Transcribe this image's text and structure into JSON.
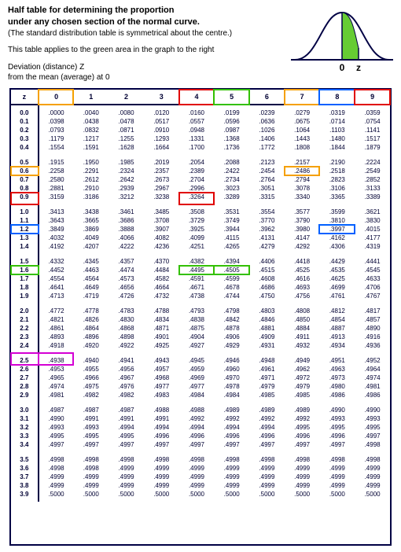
{
  "header": {
    "title": "Half table for determining the proportion",
    "title2": "under any chosen section of the normal curve.",
    "note": "(The standard distribution table is symmetrical about the centre.)",
    "applies": "This table applies to the green area in the graph to the right",
    "dev1": "Deviation (distance) Z",
    "dev2": "from the mean (average) at 0"
  },
  "curve": {
    "zero": "0",
    "z": "z"
  },
  "columns": [
    "z",
    "0",
    "1",
    "2",
    "3",
    "4",
    "5",
    "6",
    "7",
    "8",
    "9"
  ],
  "z_labels": [
    "0.0",
    "0.1",
    "0.2",
    "0.3",
    "0.4",
    "0.5",
    "0.6",
    "0.7",
    "0.8",
    "0.9",
    "1.0",
    "1.1",
    "1.2",
    "1.3",
    "1.4",
    "1.5",
    "1.6",
    "1.7",
    "1.8",
    "1.9",
    "2.0",
    "2.1",
    "2.2",
    "2.3",
    "2.4",
    "2.5",
    "2.6",
    "2.7",
    "2.8",
    "2.9",
    "3.0",
    "3.1",
    "3.2",
    "3.3",
    "3.4",
    "3.5",
    "3.6",
    "3.7",
    "3.8",
    "3.9"
  ],
  "rows": [
    [
      ".0000",
      ".0040",
      ".0080",
      ".0120",
      ".0160",
      ".0199",
      ".0239",
      ".0279",
      ".0319",
      ".0359"
    ],
    [
      ".0398",
      ".0438",
      ".0478",
      ".0517",
      ".0557",
      ".0596",
      ".0636",
      ".0675",
      ".0714",
      ".0754"
    ],
    [
      ".0793",
      ".0832",
      ".0871",
      ".0910",
      ".0948",
      ".0987",
      ".1026",
      ".1064",
      ".1103",
      ".1141"
    ],
    [
      ".1179",
      ".1217",
      ".1255",
      ".1293",
      ".1331",
      ".1368",
      ".1406",
      ".1443",
      ".1480",
      ".1517"
    ],
    [
      ".1554",
      ".1591",
      ".1628",
      ".1664",
      ".1700",
      ".1736",
      ".1772",
      ".1808",
      ".1844",
      ".1879"
    ],
    [
      ".1915",
      ".1950",
      ".1985",
      ".2019",
      ".2054",
      ".2088",
      ".2123",
      ".2157",
      ".2190",
      ".2224"
    ],
    [
      ".2258",
      ".2291",
      ".2324",
      ".2357",
      ".2389",
      ".2422",
      ".2454",
      ".2486",
      ".2518",
      ".2549"
    ],
    [
      ".2580",
      ".2612",
      ".2642",
      ".2673",
      ".2704",
      ".2734",
      ".2764",
      ".2794",
      ".2823",
      ".2852"
    ],
    [
      ".2881",
      ".2910",
      ".2939",
      ".2967",
      ".2996",
      ".3023",
      ".3051",
      ".3078",
      ".3106",
      ".3133"
    ],
    [
      ".3159",
      ".3186",
      ".3212",
      ".3238",
      ".3264",
      ".3289",
      ".3315",
      ".3340",
      ".3365",
      ".3389"
    ],
    [
      ".3413",
      ".3438",
      ".3461",
      ".3485",
      ".3508",
      ".3531",
      ".3554",
      ".3577",
      ".3599",
      ".3621"
    ],
    [
      ".3643",
      ".3665",
      ".3686",
      ".3708",
      ".3729",
      ".3749",
      ".3770",
      ".3790",
      ".3810",
      ".3830"
    ],
    [
      ".3849",
      ".3869",
      ".3888",
      ".3907",
      ".3925",
      ".3944",
      ".3962",
      ".3980",
      ".3997",
      ".4015"
    ],
    [
      ".4032",
      ".4049",
      ".4066",
      ".4082",
      ".4099",
      ".4115",
      ".4131",
      ".4147",
      ".4162",
      ".4177"
    ],
    [
      ".4192",
      ".4207",
      ".4222",
      ".4236",
      ".4251",
      ".4265",
      ".4279",
      ".4292",
      ".4306",
      ".4319"
    ],
    [
      ".4332",
      ".4345",
      ".4357",
      ".4370",
      ".4382",
      ".4394",
      ".4406",
      ".4418",
      ".4429",
      ".4441"
    ],
    [
      ".4452",
      ".4463",
      ".4474",
      ".4484",
      ".4495",
      ".4505",
      ".4515",
      ".4525",
      ".4535",
      ".4545"
    ],
    [
      ".4554",
      ".4564",
      ".4573",
      ".4582",
      ".4591",
      ".4599",
      ".4608",
      ".4616",
      ".4625",
      ".4633"
    ],
    [
      ".4641",
      ".4649",
      ".4656",
      ".4664",
      ".4671",
      ".4678",
      ".4686",
      ".4693",
      ".4699",
      ".4706"
    ],
    [
      ".4713",
      ".4719",
      ".4726",
      ".4732",
      ".4738",
      ".4744",
      ".4750",
      ".4756",
      ".4761",
      ".4767"
    ],
    [
      ".4772",
      ".4778",
      ".4783",
      ".4788",
      ".4793",
      ".4798",
      ".4803",
      ".4808",
      ".4812",
      ".4817"
    ],
    [
      ".4821",
      ".4826",
      ".4830",
      ".4834",
      ".4838",
      ".4842",
      ".4846",
      ".4850",
      ".4854",
      ".4857"
    ],
    [
      ".4861",
      ".4864",
      ".4868",
      ".4871",
      ".4875",
      ".4878",
      ".4881",
      ".4884",
      ".4887",
      ".4890"
    ],
    [
      ".4893",
      ".4896",
      ".4898",
      ".4901",
      ".4904",
      ".4906",
      ".4909",
      ".4911",
      ".4913",
      ".4916"
    ],
    [
      ".4918",
      ".4920",
      ".4922",
      ".4925",
      ".4927",
      ".4929",
      ".4931",
      ".4932",
      ".4934",
      ".4936"
    ],
    [
      ".4938",
      ".4940",
      ".4941",
      ".4943",
      ".4945",
      ".4946",
      ".4948",
      ".4949",
      ".4951",
      ".4952"
    ],
    [
      ".4953",
      ".4955",
      ".4956",
      ".4957",
      ".4959",
      ".4960",
      ".4961",
      ".4962",
      ".4963",
      ".4964"
    ],
    [
      ".4965",
      ".4966",
      ".4967",
      ".4968",
      ".4969",
      ".4970",
      ".4971",
      ".4972",
      ".4973",
      ".4974"
    ],
    [
      ".4974",
      ".4975",
      ".4976",
      ".4977",
      ".4977",
      ".4978",
      ".4979",
      ".4979",
      ".4980",
      ".4981"
    ],
    [
      ".4981",
      ".4982",
      ".4982",
      ".4983",
      ".4984",
      ".4984",
      ".4985",
      ".4985",
      ".4986",
      ".4986"
    ],
    [
      ".4987",
      ".4987",
      ".4987",
      ".4988",
      ".4988",
      ".4989",
      ".4989",
      ".4989",
      ".4990",
      ".4990"
    ],
    [
      ".4990",
      ".4991",
      ".4991",
      ".4991",
      ".4992",
      ".4992",
      ".4992",
      ".4992",
      ".4993",
      ".4993"
    ],
    [
      ".4993",
      ".4993",
      ".4994",
      ".4994",
      ".4994",
      ".4994",
      ".4994",
      ".4995",
      ".4995",
      ".4995"
    ],
    [
      ".4995",
      ".4995",
      ".4995",
      ".4996",
      ".4996",
      ".4996",
      ".4996",
      ".4996",
      ".4996",
      ".4997"
    ],
    [
      ".4997",
      ".4997",
      ".4997",
      ".4997",
      ".4997",
      ".4997",
      ".4997",
      ".4997",
      ".4997",
      ".4998"
    ],
    [
      ".4998",
      ".4998",
      ".4998",
      ".4998",
      ".4998",
      ".4998",
      ".4998",
      ".4998",
      ".4998",
      ".4998"
    ],
    [
      ".4998",
      ".4998",
      ".4999",
      ".4999",
      ".4999",
      ".4999",
      ".4999",
      ".4999",
      ".4999",
      ".4999"
    ],
    [
      ".4999",
      ".4999",
      ".4999",
      ".4999",
      ".4999",
      ".4999",
      ".4999",
      ".4999",
      ".4999",
      ".4999"
    ],
    [
      ".4999",
      ".4999",
      ".4999",
      ".4999",
      ".4999",
      ".4999",
      ".4999",
      ".4999",
      ".4999",
      ".4999"
    ],
    [
      ".5000",
      ".5000",
      ".5000",
      ".5000",
      ".5000",
      ".5000",
      ".5000",
      ".5000",
      ".5000",
      ".5000"
    ]
  ],
  "highlights": {
    "header_cells": {
      "0": "orange",
      "4": "red",
      "5": "green",
      "7": "orange",
      "8": "blue",
      "9": "red"
    },
    "z_cells": {
      "0.6": "orange",
      "0.9": "red",
      "1.2": "blue",
      "1.6": "green",
      "2.5": "magenta"
    },
    "body_cells": [
      {
        "row": 6,
        "col": 7,
        "color": "orange"
      },
      {
        "row": 9,
        "col": 4,
        "color": "red"
      },
      {
        "row": 12,
        "col": 8,
        "color": "blue"
      },
      {
        "row": 16,
        "col": 4,
        "color": "green"
      },
      {
        "row": 16,
        "col": 5,
        "color": "green"
      },
      {
        "row": 25,
        "col": 0,
        "color": "magenta"
      }
    ]
  }
}
